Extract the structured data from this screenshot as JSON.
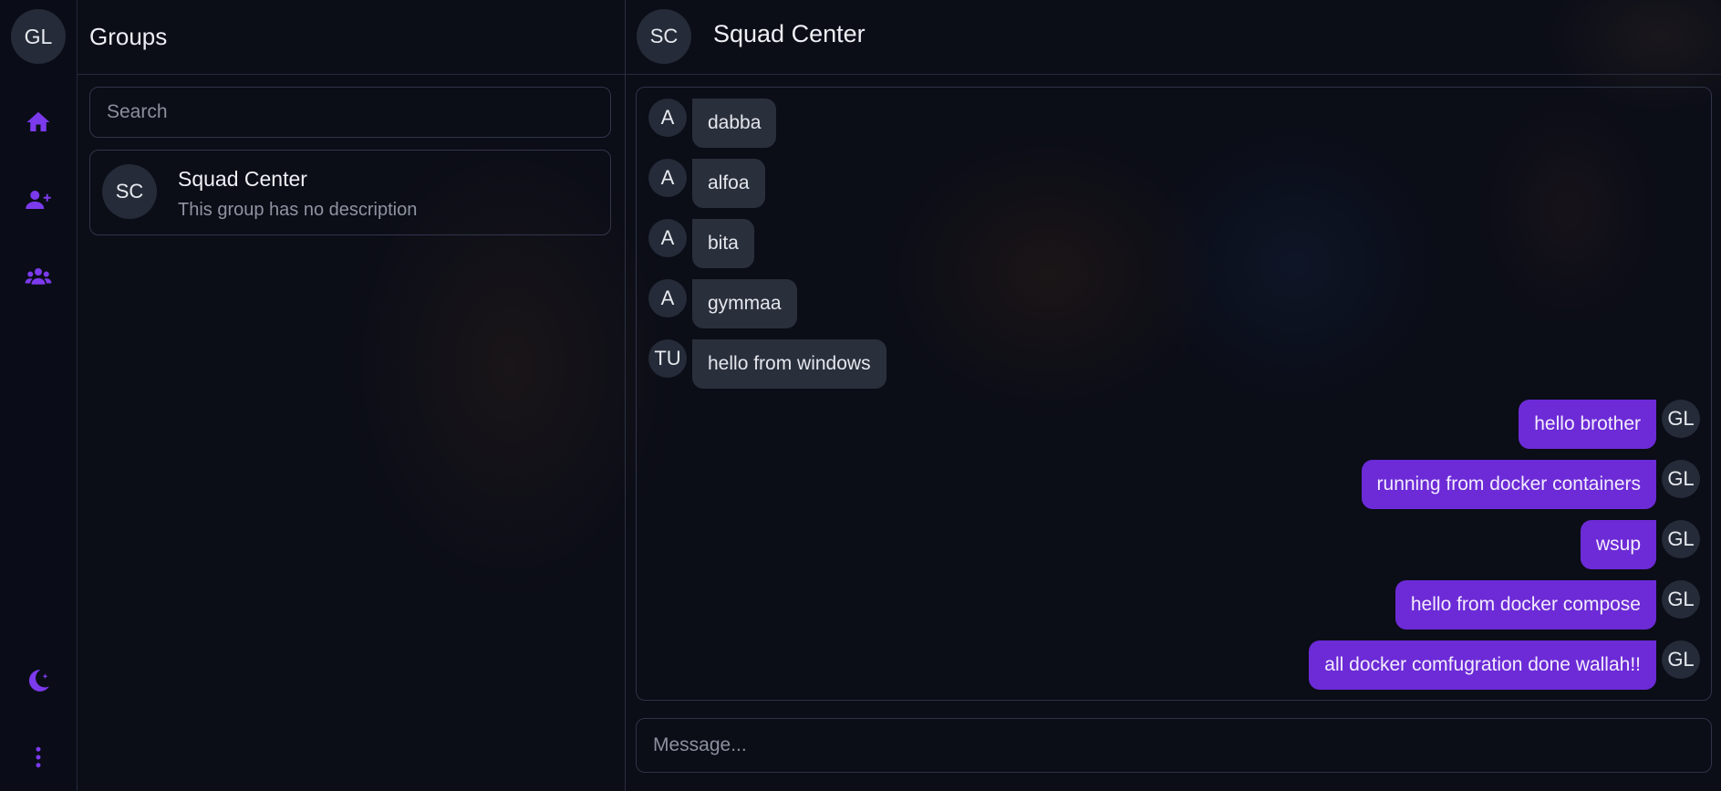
{
  "colors": {
    "accent": "#6c2bd6",
    "icon": "#7c3aed",
    "background": "#0b0d17"
  },
  "rail": {
    "user_initials": "GL",
    "icons": [
      "home-icon",
      "add-user-icon",
      "group-icon",
      "theme-moon-icon",
      "more-vertical-icon"
    ]
  },
  "groups_panel": {
    "title": "Groups",
    "search_placeholder": "Search",
    "items": [
      {
        "initials": "SC",
        "name": "Squad Center",
        "description": "This group has no description"
      }
    ]
  },
  "chat": {
    "initials": "SC",
    "title": "Squad Center",
    "messages": [
      {
        "side": "in",
        "avatar": "A",
        "text": "dabba"
      },
      {
        "side": "in",
        "avatar": "A",
        "text": "alfoa"
      },
      {
        "side": "in",
        "avatar": "A",
        "text": "bita"
      },
      {
        "side": "in",
        "avatar": "A",
        "text": "gymmaa"
      },
      {
        "side": "in",
        "avatar": "TU",
        "text": "hello from windows"
      },
      {
        "side": "out",
        "avatar": "GL",
        "text": "hello brother"
      },
      {
        "side": "out",
        "avatar": "GL",
        "text": "running from docker containers"
      },
      {
        "side": "out",
        "avatar": "GL",
        "text": "wsup"
      },
      {
        "side": "out",
        "avatar": "GL",
        "text": "hello from docker compose"
      },
      {
        "side": "out",
        "avatar": "GL",
        "text": "all docker comfugration done wallah!!"
      }
    ],
    "composer_placeholder": "Message..."
  }
}
